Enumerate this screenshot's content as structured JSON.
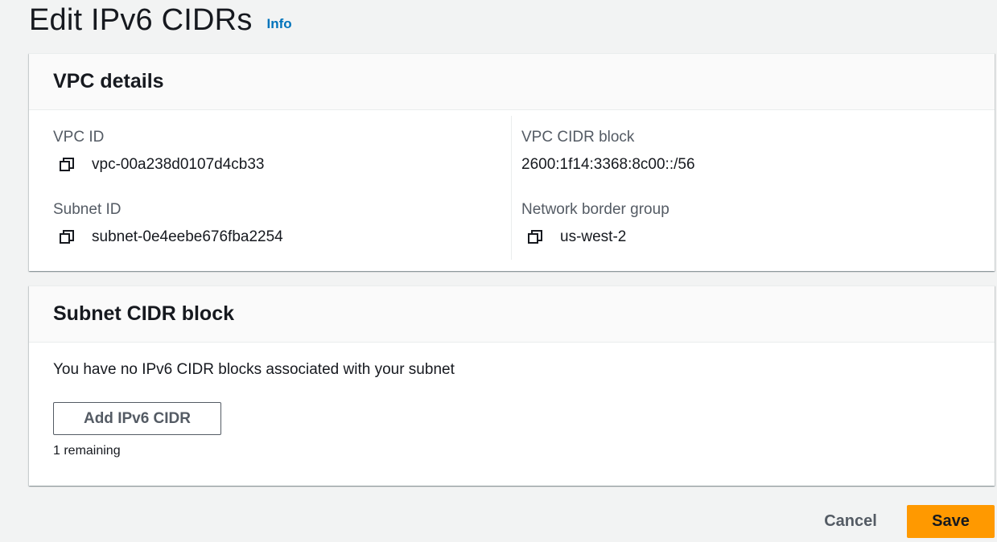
{
  "header": {
    "title": "Edit IPv6 CIDRs",
    "info_label": "Info"
  },
  "vpc_details": {
    "title": "VPC details",
    "vpc_id": {
      "label": "VPC ID",
      "value": "vpc-00a238d0107d4cb33",
      "icon": "copy-icon"
    },
    "subnet_id": {
      "label": "Subnet ID",
      "value": "subnet-0e4eebe676fba2254",
      "icon": "copy-icon"
    },
    "vpc_cidr_block": {
      "label": "VPC CIDR block",
      "value": "2600:1f14:3368:8c00::/56"
    },
    "network_border_group": {
      "label": "Network border group",
      "value": "us-west-2",
      "icon": "copy-icon"
    }
  },
  "subnet_cidr_block": {
    "title": "Subnet CIDR block",
    "empty_message": "You have no IPv6 CIDR blocks associated with your subnet",
    "add_button_label": "Add IPv6 CIDR",
    "remaining_text": "1 remaining"
  },
  "actions": {
    "cancel_label": "Cancel",
    "save_label": "Save"
  },
  "colors": {
    "accent": "#ff9900",
    "link": "#0073bb",
    "background": "#f2f3f3"
  }
}
